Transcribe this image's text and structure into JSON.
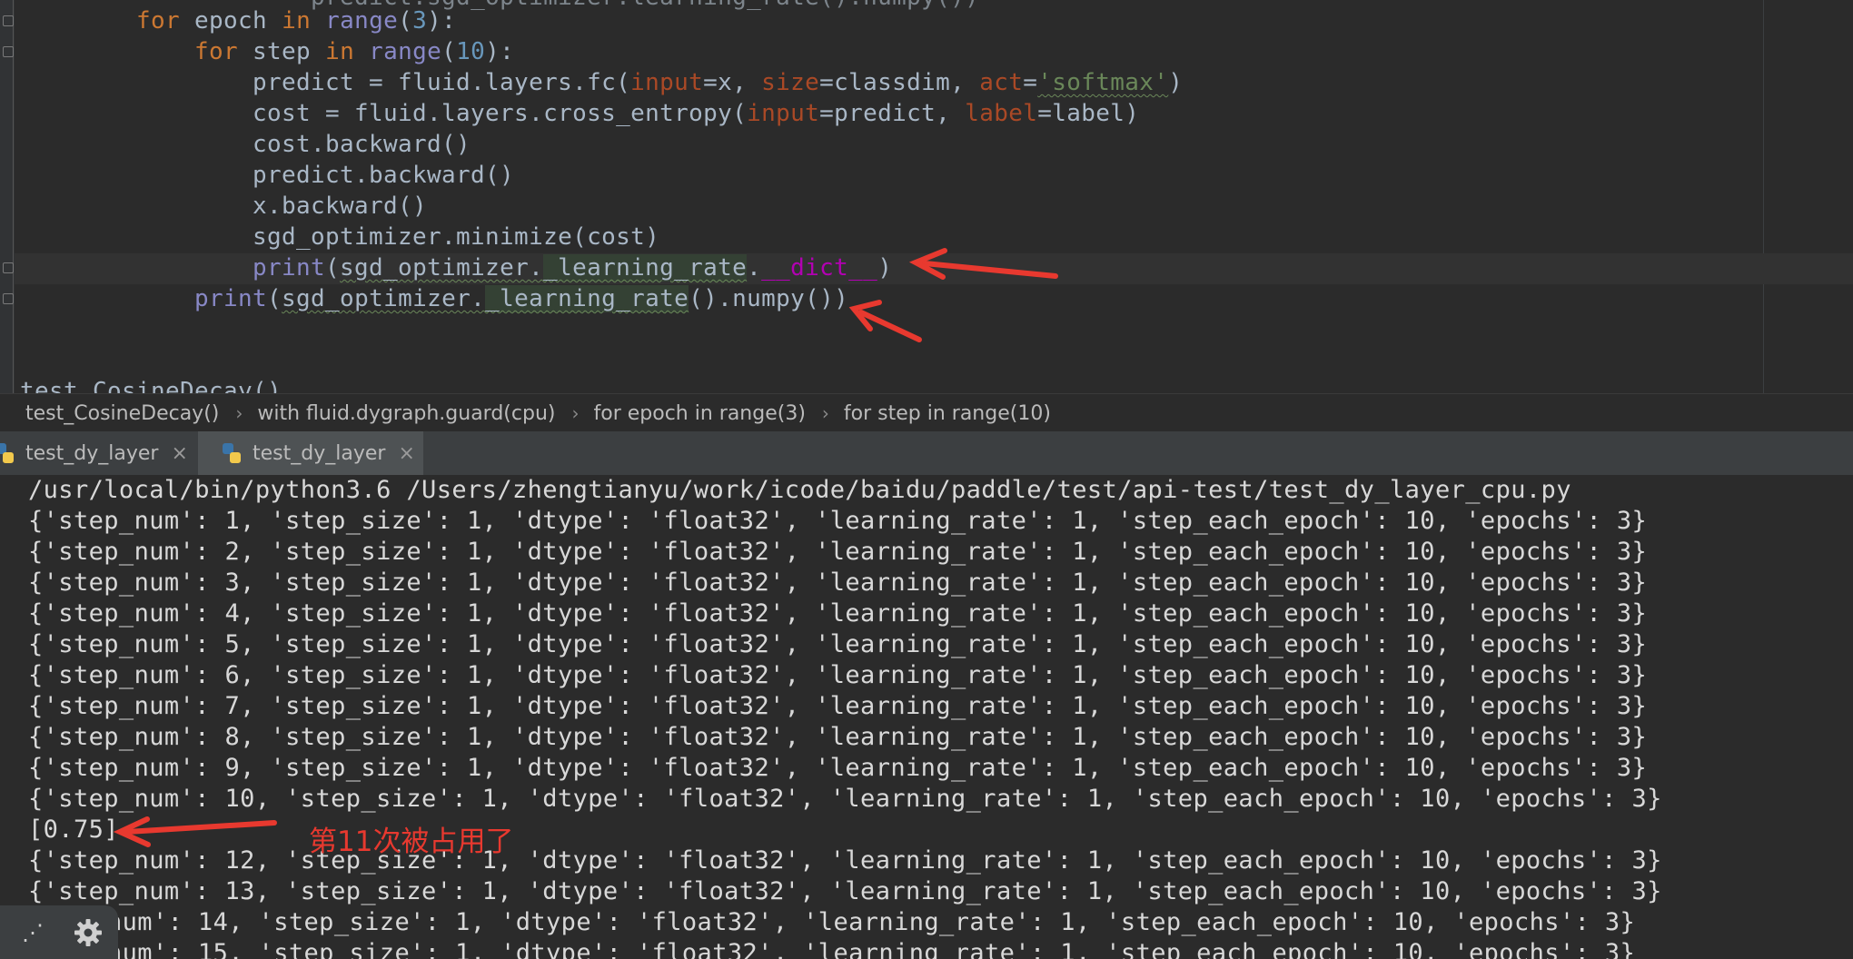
{
  "editor": {
    "lines": {
      "top_partial": "        predict.sgd_optimizer.learning_rate().numpy())",
      "for_epoch": {
        "kw_for": "for",
        "var": "epoch",
        "kw_in": "in",
        "fn": "range",
        "open": "(",
        "num": "3",
        "close": "):"
      },
      "for_step": {
        "kw_for": "for",
        "var": "step",
        "kw_in": "in",
        "fn": "range",
        "open": "(",
        "num": "10",
        "close": "):"
      },
      "predict": {
        "a": "predict = fluid.layers.fc(",
        "p1": "input",
        "b": "=x, ",
        "p2": "size",
        "c": "=classdim, ",
        "p3": "act",
        "d": "=",
        "s": "'softmax'",
        "e": ")"
      },
      "cost": {
        "a": "cost = fluid.layers.cross_entropy(",
        "p1": "input",
        "b": "=predict, ",
        "p2": "label",
        "c": "=label)"
      },
      "cost_backward": "cost.backward()",
      "predict_backward": "predict.backward()",
      "x_backward": "x.backward()",
      "minimize": "sgd_optimizer.minimize(cost)",
      "print1": {
        "fn": "print",
        "open": "(",
        "obj": "sgd_optimizer.",
        "attr": "_learning_rate",
        "dot": ".",
        "dunder": "__dict__",
        "close": ")"
      },
      "print2": {
        "fn": "print",
        "open": "(",
        "obj": "sgd_optimizer.",
        "attr": "_learning_rate",
        "rest": "().numpy())"
      },
      "bottom_partial": "test_CosineDecay()"
    }
  },
  "breadcrumb": [
    "test_CosineDecay()",
    "with fluid.dygraph.guard(cpu)",
    "for epoch in range(3)",
    "for step in range(10)"
  ],
  "tabs": [
    {
      "label": "test_dy_layer",
      "close": "×"
    },
    {
      "label": "test_dy_layer",
      "close": "×"
    }
  ],
  "console": {
    "command": "/usr/local/bin/python3.6 /Users/zhengtianyu/work/icode/baidu/paddle/test/api-test/test_dy_layer_cpu.py",
    "lines": [
      "{'step_num': 1, 'step_size': 1, 'dtype': 'float32', 'learning_rate': 1, 'step_each_epoch': 10, 'epochs': 3}",
      "{'step_num': 2, 'step_size': 1, 'dtype': 'float32', 'learning_rate': 1, 'step_each_epoch': 10, 'epochs': 3}",
      "{'step_num': 3, 'step_size': 1, 'dtype': 'float32', 'learning_rate': 1, 'step_each_epoch': 10, 'epochs': 3}",
      "{'step_num': 4, 'step_size': 1, 'dtype': 'float32', 'learning_rate': 1, 'step_each_epoch': 10, 'epochs': 3}",
      "{'step_num': 5, 'step_size': 1, 'dtype': 'float32', 'learning_rate': 1, 'step_each_epoch': 10, 'epochs': 3}",
      "{'step_num': 6, 'step_size': 1, 'dtype': 'float32', 'learning_rate': 1, 'step_each_epoch': 10, 'epochs': 3}",
      "{'step_num': 7, 'step_size': 1, 'dtype': 'float32', 'learning_rate': 1, 'step_each_epoch': 10, 'epochs': 3}",
      "{'step_num': 8, 'step_size': 1, 'dtype': 'float32', 'learning_rate': 1, 'step_each_epoch': 10, 'epochs': 3}",
      "{'step_num': 9, 'step_size': 1, 'dtype': 'float32', 'learning_rate': 1, 'step_each_epoch': 10, 'epochs': 3}",
      "{'step_num': 10, 'step_size': 1, 'dtype': 'float32', 'learning_rate': 1, 'step_each_epoch': 10, 'epochs': 3}",
      "[0.75]",
      "{'step_num': 12, 'step_size': 1, 'dtype': 'float32', 'learning_rate': 1, 'step_each_epoch': 10, 'epochs': 3}",
      "{'step_num': 13, 'step_size': 1, 'dtype': 'float32', 'learning_rate': 1, 'step_each_epoch': 10, 'epochs': 3}",
      "num': 14, 'step_size': 1, 'dtype': 'float32', 'learning_rate': 1, 'step_each_epoch': 10, 'epochs': 3}",
      "num': 15, 'step_size': 1, 'dtype': 'float32', 'learning_rate': 1, 'step_each_epoch': 10, 'epochs': 3}"
    ],
    "annotation": "第11次被占用了"
  },
  "toolstrip": {
    "dots": "⋰",
    "gear_icon": "gear-icon"
  },
  "colors": {
    "arrow": "#e8392f",
    "keyword": "#cc7832",
    "string": "#6a8759",
    "number": "#6897bb"
  }
}
